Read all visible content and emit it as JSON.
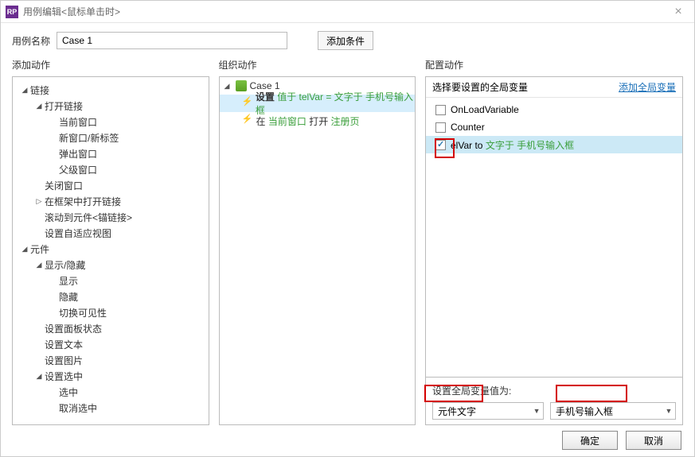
{
  "window": {
    "title": "用例编辑<鼠标单击时>",
    "logo_text": "RP"
  },
  "name_row": {
    "label": "用例名称",
    "value": "Case 1",
    "add_condition": "添加条件"
  },
  "columns": {
    "add_action": "添加动作",
    "organize": "组织动作",
    "configure": "配置动作"
  },
  "tree": {
    "g_link": "链接",
    "g_open_link": "打开链接",
    "current_window": "当前窗口",
    "new_window_tab": "新窗口/新标签",
    "popup": "弹出窗口",
    "parent_window": "父级窗口",
    "close_window": "关闭窗口",
    "open_in_frame": "在框架中打开链接",
    "scroll_to_anchor": "滚动到元件<锚链接>",
    "set_adaptive": "设置自适应视图",
    "g_widget": "元件",
    "g_showhide": "显示/隐藏",
    "show": "显示",
    "hide": "隐藏",
    "toggle_vis": "切换可见性",
    "set_panel_state": "设置面板状态",
    "set_text": "设置文本",
    "set_image": "设置图片",
    "g_set_selected": "设置选中",
    "selected": "选中",
    "unselect": "取消选中"
  },
  "org": {
    "case_label": "Case 1",
    "set_prefix": "设置",
    "set_green": "值于 telVar = 文字于 手机号输入框",
    "in_prefix": "在",
    "in_green1": "当前窗口",
    "in_mid": " 打开 ",
    "in_green2": "注册页"
  },
  "cfg": {
    "head_label": "选择要设置的全局变量",
    "add_global_link": "添加全局变量",
    "vars": [
      {
        "name": "OnLoadVariable",
        "checked": false
      },
      {
        "name": "Counter",
        "checked": false
      }
    ],
    "sel_var_label_prefix": "elVar to ",
    "sel_var_green": "文字于 手机号输入框",
    "set_value_label": "设置全局变量值为:",
    "combo1_value": "元件文字",
    "combo2_value": "手机号输入框"
  },
  "footer": {
    "ok": "确定",
    "cancel": "取消"
  }
}
